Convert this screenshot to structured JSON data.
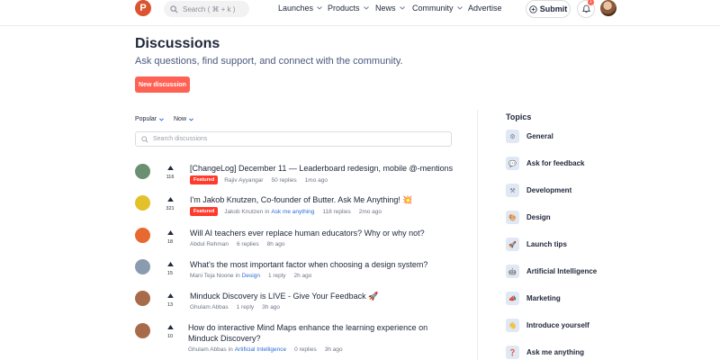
{
  "header": {
    "logo_letter": "P",
    "search_placeholder": "Search ( ⌘ + k )",
    "nav": [
      {
        "label": "Launches",
        "has_dropdown": true
      },
      {
        "label": "Products",
        "has_dropdown": true
      },
      {
        "label": "News",
        "has_dropdown": true
      },
      {
        "label": "Community",
        "has_dropdown": true
      },
      {
        "label": "Advertise",
        "has_dropdown": false
      }
    ],
    "submit_label": "Submit",
    "notification_count": "1"
  },
  "page": {
    "title": "Discussions",
    "subtitle": "Ask questions, find support, and connect with the community.",
    "new_button": "New discussion"
  },
  "filters": {
    "sort": "Popular",
    "time": "Now",
    "search_placeholder": "Search discussions"
  },
  "discussions": [
    {
      "title": "[ChangeLog] December 11 — Leaderboard redesign, mobile @-mentions",
      "votes": "116",
      "featured": true,
      "badge": "Featured",
      "author": "Rajiv Ayyangar",
      "in_label": "",
      "topic": "",
      "replies": "50 replies",
      "time": "1mo ago",
      "avatar_color": "#6b8f71"
    },
    {
      "title": "I'm Jakob Knutzen, Co-founder of Butter. Ask Me Anything! 💥",
      "votes": "321",
      "featured": true,
      "badge": "Featured",
      "author": "Jakob Knutzen",
      "in_label": "in",
      "topic": "Ask me anything",
      "replies": "118 replies",
      "time": "2mo ago",
      "avatar_color": "#e3c12b"
    },
    {
      "title": "Will AI teachers ever replace human educators? Why or why not?",
      "votes": "18",
      "featured": false,
      "badge": "",
      "author": "Abdul Rehman",
      "in_label": "",
      "topic": "",
      "replies": "6 replies",
      "time": "8h ago",
      "avatar_color": "#e8692f"
    },
    {
      "title": "What's the most important factor when choosing a design system?",
      "votes": "15",
      "featured": false,
      "badge": "",
      "author": "Mani Teja Noone",
      "in_label": "in",
      "topic": "Design",
      "replies": "1 reply",
      "time": "2h ago",
      "avatar_color": "#8a9bb0"
    },
    {
      "title": "Minduck Discovery is LIVE - Give Your Feedback 🚀",
      "votes": "13",
      "featured": false,
      "badge": "",
      "author": "Ghulam Abbas",
      "in_label": "",
      "topic": "",
      "replies": "1 reply",
      "time": "3h ago",
      "avatar_color": "#a86b4a"
    },
    {
      "title": "How do interactive Mind Maps enhance the learning experience on Minduck Discovery?",
      "votes": "10",
      "featured": false,
      "badge": "",
      "author": "Ghulam Abbas",
      "in_label": "in",
      "topic": "Artificial Intelligence",
      "replies": "0 replies",
      "time": "3h ago",
      "avatar_color": "#a86b4a"
    }
  ],
  "sidebar": {
    "title": "Topics",
    "topics": [
      {
        "label": "General",
        "icon": "gear-icon",
        "glyph": "⚙"
      },
      {
        "label": "Ask for feedback",
        "icon": "chat-icon",
        "glyph": "💬"
      },
      {
        "label": "Development",
        "icon": "code-icon",
        "glyph": "⚒"
      },
      {
        "label": "Design",
        "icon": "palette-icon",
        "glyph": "🎨"
      },
      {
        "label": "Launch tips",
        "icon": "rocket-icon",
        "glyph": "🚀"
      },
      {
        "label": "Artificial Intelligence",
        "icon": "robot-icon",
        "glyph": "🤖"
      },
      {
        "label": "Marketing",
        "icon": "megaphone-icon",
        "glyph": "📣"
      },
      {
        "label": "Introduce yourself",
        "icon": "wave-icon",
        "glyph": "👋"
      },
      {
        "label": "Ask me anything",
        "icon": "question-icon",
        "glyph": "❓"
      }
    ]
  },
  "colors": {
    "brand": "#da552f",
    "accent": "#ff6154",
    "featured": "#ff3b2e",
    "link": "#2e6bd9"
  }
}
